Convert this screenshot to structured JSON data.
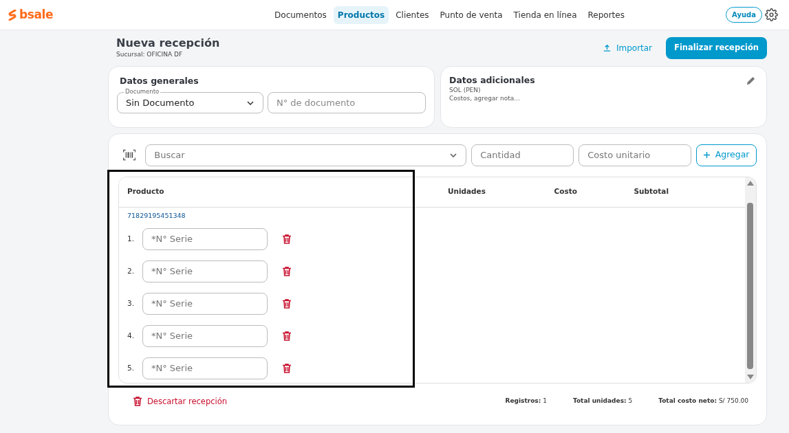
{
  "logo": {
    "text": "bsale"
  },
  "nav": [
    {
      "label": "Documentos",
      "selected": false
    },
    {
      "label": "Productos",
      "selected": true
    },
    {
      "label": "Clientes",
      "selected": false
    },
    {
      "label": "Punto de venta",
      "selected": false
    },
    {
      "label": "Tienda en línea",
      "selected": false
    },
    {
      "label": "Reportes",
      "selected": false
    }
  ],
  "help_button": "Ayuda",
  "page": {
    "title": "Nueva recepción",
    "subtitle": "Sucursal: OFICINA DF",
    "import_button": "Importar",
    "finish_button": "Finalizar recepción"
  },
  "general": {
    "title": "Datos generales",
    "document_label": "Documento",
    "document_value": "Sin Documento",
    "number_placeholder": "N° de documento"
  },
  "additional": {
    "title": "Datos adicionales",
    "currency": "SOL (PEN)",
    "note": "Costos, agregar nota..."
  },
  "entry": {
    "search_placeholder": "Buscar",
    "quantity_placeholder": "Cantidad",
    "cost_placeholder": "Costo unitario",
    "add_button": "Agregar"
  },
  "table": {
    "columns": [
      "Producto",
      "Unidades",
      "Costo",
      "Subtotal"
    ],
    "row": {
      "code": "71829195451348"
    },
    "serials": [
      {
        "index": "1.",
        "placeholder": "*N° Serie"
      },
      {
        "index": "2.",
        "placeholder": "*N° Serie"
      },
      {
        "index": "3.",
        "placeholder": "*N° Serie"
      },
      {
        "index": "4.",
        "placeholder": "*N° Serie"
      },
      {
        "index": "5.",
        "placeholder": "*N° Serie"
      }
    ]
  },
  "footer": {
    "discard_button": "Descartar recepción",
    "totals": [
      {
        "label": "Registros:",
        "value": "1"
      },
      {
        "label": "Total unidades:",
        "value": "5"
      },
      {
        "label": "Total costo neto:",
        "value": "S/ 750.00"
      }
    ]
  }
}
